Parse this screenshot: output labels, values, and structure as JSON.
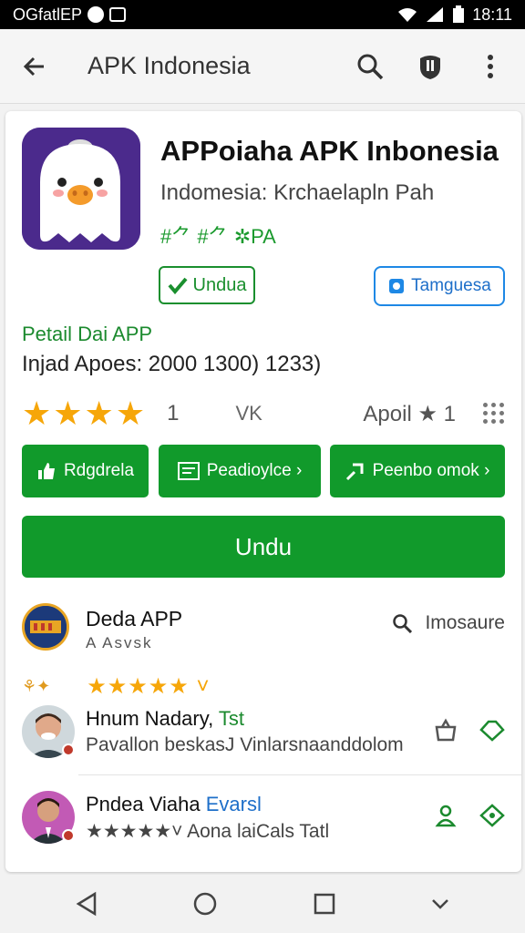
{
  "status_bar": {
    "left_text": "OGfatlEP",
    "time": "18:11"
  },
  "app_bar": {
    "title": "APK Indonesia"
  },
  "app": {
    "name": "APPoiaha APK Inbonesia",
    "developer": "Indomesia: Krchaelapln Pah",
    "tags": "#⺈ #⺈ ✲PA",
    "unduh_small": "Undua",
    "tanggapan": "Tamguesa"
  },
  "detail": {
    "title": "Petail Dai APP",
    "value": "Injad Apoes: 2000  1300)  1233)"
  },
  "rating": {
    "stars": "★★★★",
    "count": "1",
    "vk": "VK",
    "date": "Apoil ★ 1"
  },
  "actions": [
    {
      "label": "Rdgdrela"
    },
    {
      "label": "Peadioylce ›"
    },
    {
      "label": "Peenbo omok ›"
    }
  ],
  "download": {
    "label": "Undu"
  },
  "section": {
    "title": "Deda APP",
    "subtitle": "A Asvsk",
    "right_label": "Imosaure"
  },
  "mini_rating": {
    "leaf": "⚘✦",
    "stars": "★★★★★ ˅"
  },
  "reviews": [
    {
      "name": "Hnum Nadary, ",
      "name_accent": "Tst",
      "text": "Pavallon beskasJ Vinlarsnaanddolom"
    },
    {
      "name": "Pndea Viaha ",
      "name_accent": "Evarsl",
      "text": "★★★★★˅  Aona laiCals Tatl"
    }
  ],
  "colors": {
    "green": "#119a2b",
    "accent_blue": "#1e88e5",
    "star": "#f6a609"
  }
}
